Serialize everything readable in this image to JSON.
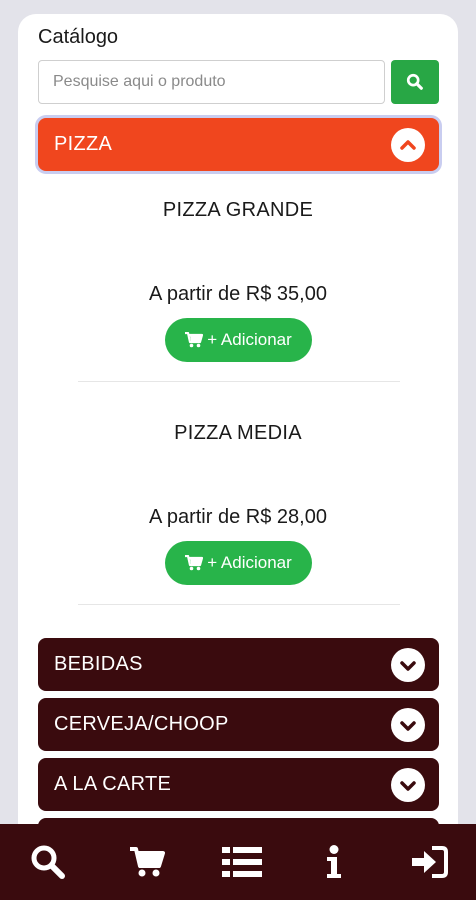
{
  "catalog": {
    "title": "Catálogo",
    "search": {
      "placeholder": "Pesquise aqui o produto",
      "value": ""
    },
    "search_button_icon": "search-icon"
  },
  "categories": [
    {
      "label": "PIZZA",
      "expanded": true,
      "icon": "chevron-up-icon"
    },
    {
      "label": "BEBIDAS",
      "expanded": false,
      "icon": "chevron-down-icon"
    },
    {
      "label": "CERVEJA/CHOOP",
      "expanded": false,
      "icon": "chevron-down-icon"
    },
    {
      "label": "A LA CARTE",
      "expanded": false,
      "icon": "chevron-down-icon"
    }
  ],
  "products": [
    {
      "name": "PIZZA GRANDE",
      "price": "A partir de R$ 35,00",
      "add_label": "+ Adicionar"
    },
    {
      "name": "PIZZA MEDIA",
      "price": "A partir de R$ 28,00",
      "add_label": "+ Adicionar"
    }
  ],
  "bottom_nav": [
    {
      "icon": "search-icon"
    },
    {
      "icon": "cart-icon"
    },
    {
      "icon": "list-icon"
    },
    {
      "icon": "info-icon"
    },
    {
      "icon": "sign-in-icon"
    }
  ],
  "colors": {
    "active_category": "#f0461e",
    "dark_category": "#3a0b0e",
    "green": "#28a745",
    "bottom_bar": "#3a0b0e"
  }
}
